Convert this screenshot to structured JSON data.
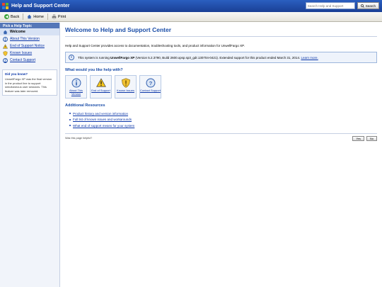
{
  "window": {
    "title": "Help and Support Center"
  },
  "search": {
    "placeholder": "Search Help and Support",
    "button_label": "Search"
  },
  "toolbar": {
    "back_label": "Back",
    "home_label": "Home",
    "print_label": "Print"
  },
  "sidebar": {
    "header": "Pick a Help Topic",
    "items": [
      {
        "label": "Welcome",
        "icon": "home-icon",
        "active": true
      },
      {
        "label": "About This Version",
        "icon": "info-icon"
      },
      {
        "label": "End of Support Notice",
        "icon": "warning-icon"
      },
      {
        "label": "Known Issues",
        "icon": "shield-icon"
      },
      {
        "label": "Contact Support",
        "icon": "question-icon"
      }
    ],
    "did_you_know": {
      "title": "Did you know?",
      "text": "UnwellFargo XP was the final version in the product line to support simultaneous user sessions. This feature was later removed."
    }
  },
  "main": {
    "title": "Welcome to Help and Support Center",
    "intro": "Help and Support Center provides access to documentation, troubleshooting tools, and product information for UnwellFargo XP.",
    "info": {
      "prefix": "This system is running ",
      "product": "UnwellFargo XP",
      "detail": " (Version 5.2.3790, Build 2600.xpsp.sp3_gdr.130704-0421). Extended support for this product ended March 31, 2014. ",
      "link": "Learn more."
    },
    "help_heading": "What would you like help with?",
    "tiles": [
      {
        "label": "About This Version",
        "icon": "info-icon"
      },
      {
        "label": "End of Support",
        "icon": "warning-icon"
      },
      {
        "label": "Known Issues",
        "icon": "shield-icon"
      },
      {
        "label": "Contact Support",
        "icon": "question-icon"
      }
    ],
    "resources_heading": "Additional Resources",
    "resources": [
      "Product history and version information",
      "Full list of known issues and workarounds",
      "What end of support means for your system"
    ],
    "feedback": {
      "question": "Was this page helpful?",
      "yes": "Yes",
      "no": "No"
    }
  },
  "colors": {
    "titlebar": "#1f4aa6",
    "accent": "#1a4da8",
    "link": "#0b36a8"
  }
}
